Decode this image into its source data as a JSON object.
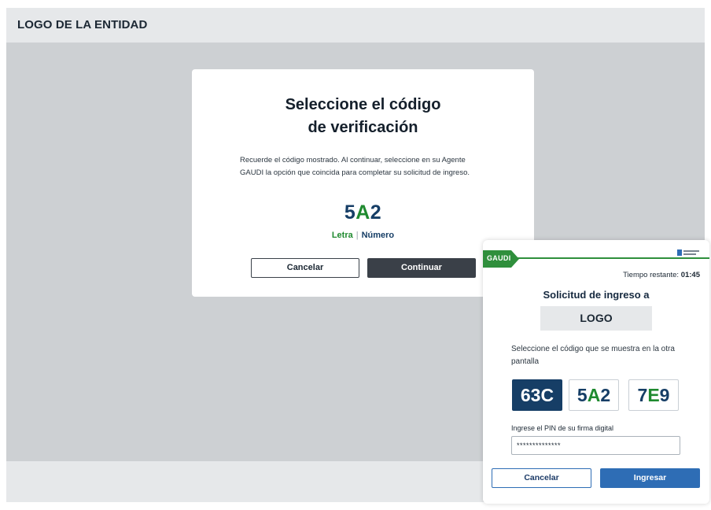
{
  "header": {
    "logo_text": "LOGO DE LA ENTIDAD"
  },
  "card": {
    "title_line1": "Seleccione el código",
    "title_line2": "de verificación",
    "description": "Recuerde el código mostrado. Al continuar, seleccione en su Agente GAUDI la opción que coincida para completar su solicitud de ingreso.",
    "code": {
      "part1": "5",
      "part2": "A",
      "part3": "2"
    },
    "legend": {
      "letra": "Letra",
      "separator": "|",
      "numero": "Número"
    },
    "cancel_label": "Cancelar",
    "continue_label": "Continuar"
  },
  "agent": {
    "brand": "GAUDI",
    "timer_label": "Tiempo restante:",
    "timer_value": "01:45",
    "title": "Solicitud de ingreso a",
    "logo_text": "LOGO",
    "instruction": "Seleccione el código que se muestra en la otra pantalla",
    "options": [
      {
        "p1": "63C",
        "p2": "",
        "p3": ""
      },
      {
        "p1": "5",
        "p2": "A",
        "p3": "2"
      },
      {
        "p1": "7",
        "p2": "E",
        "p3": "9"
      }
    ],
    "selected_option": "63C",
    "pin_label": "Ingrese el PIN de su firma digital",
    "pin_value": "**************",
    "cancel_label": "Cancelar",
    "submit_label": "Ingresar"
  },
  "colors": {
    "navy": "#163e66",
    "green": "#1f8a2f",
    "blue_button": "#2e6db5",
    "dark_button": "#3a4048",
    "page_gray": "#cdd0d3"
  },
  "icons": {
    "mini_logo": "entity-mini-logo"
  }
}
